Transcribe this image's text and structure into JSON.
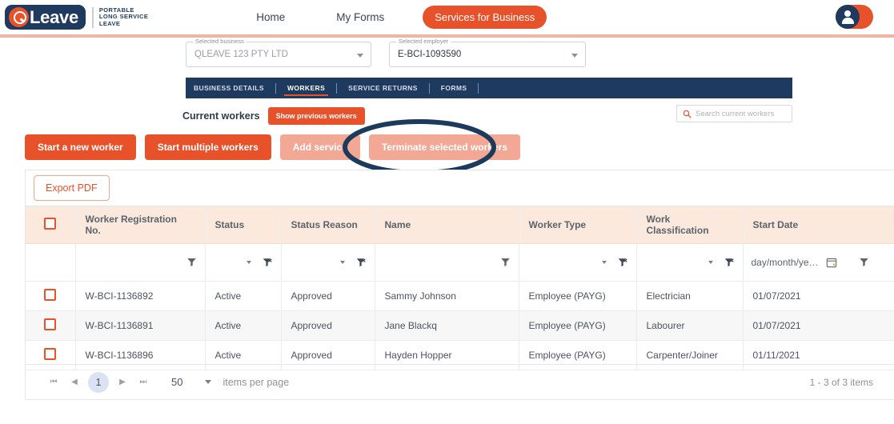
{
  "header": {
    "logo": {
      "word": "Leave",
      "tagline_lines": [
        "PORTABLE",
        "LONG SERVICE",
        "LEAVE"
      ]
    },
    "nav": [
      {
        "label": "Home",
        "active": false
      },
      {
        "label": "My Forms",
        "active": false
      }
    ],
    "pill_label": "Services for Business",
    "avatar_icon": "user-icon"
  },
  "selectors": {
    "business": {
      "label": "Selected business",
      "value": "QLEAVE 123 PTY LTD"
    },
    "employer": {
      "label": "Selected employer",
      "value": "E-BCI-1093590"
    }
  },
  "tabs": [
    {
      "label": "BUSINESS DETAILS",
      "active": false
    },
    {
      "label": "WORKERS",
      "active": true
    },
    {
      "label": "SERVICE RETURNS",
      "active": false
    },
    {
      "label": "FORMS",
      "active": false
    }
  ],
  "subheader": {
    "title": "Current workers",
    "toggle_label": "Show previous workers",
    "search_placeholder": "Search current workers",
    "search_icon": "search-icon"
  },
  "actions": [
    {
      "label": "Start a new worker",
      "enabled": true
    },
    {
      "label": "Start multiple workers",
      "enabled": true
    },
    {
      "label": "Add service",
      "enabled": false
    },
    {
      "label": "Terminate selected workers",
      "enabled": false,
      "annotated": true
    }
  ],
  "annotation": {
    "shape": "ellipse",
    "color": "#1b3a5c",
    "target": "Terminate selected workers"
  },
  "toolbar": {
    "export_label": "Export PDF"
  },
  "table": {
    "columns": [
      "Worker Registration No.",
      "Status",
      "Status Reason",
      "Name",
      "Worker Type",
      "Work Classification",
      "Start Date"
    ],
    "date_filter_placeholder": "day/month/ye…",
    "rows": [
      {
        "reg": "W-BCI-1136892",
        "status": "Active",
        "status_reason": "Approved",
        "name": "Sammy Johnson",
        "worker_type": "Employee (PAYG)",
        "classification": "Electrician",
        "start_date": "01/07/2021"
      },
      {
        "reg": "W-BCI-1136891",
        "status": "Active",
        "status_reason": "Approved",
        "name": "Jane Blackq",
        "worker_type": "Employee (PAYG)",
        "classification": "Labourer",
        "start_date": "01/07/2021"
      },
      {
        "reg": "W-BCI-1136896",
        "status": "Active",
        "status_reason": "Approved",
        "name": "Hayden Hopper",
        "worker_type": "Employee (PAYG)",
        "classification": "Carpenter/Joiner",
        "start_date": "01/11/2021"
      }
    ]
  },
  "pager": {
    "first": "⏮",
    "prev": "◀",
    "page": "1",
    "next": "▶",
    "last": "⏭",
    "page_size": "50",
    "items_per_page_label": "items per page",
    "count_label": "1 - 3 of 3 items"
  },
  "colors": {
    "brand_orange": "#e8522b",
    "brand_navy": "#1f3a5f",
    "header_cell": "#fae9dc",
    "disabled_orange": "#f2a894"
  }
}
